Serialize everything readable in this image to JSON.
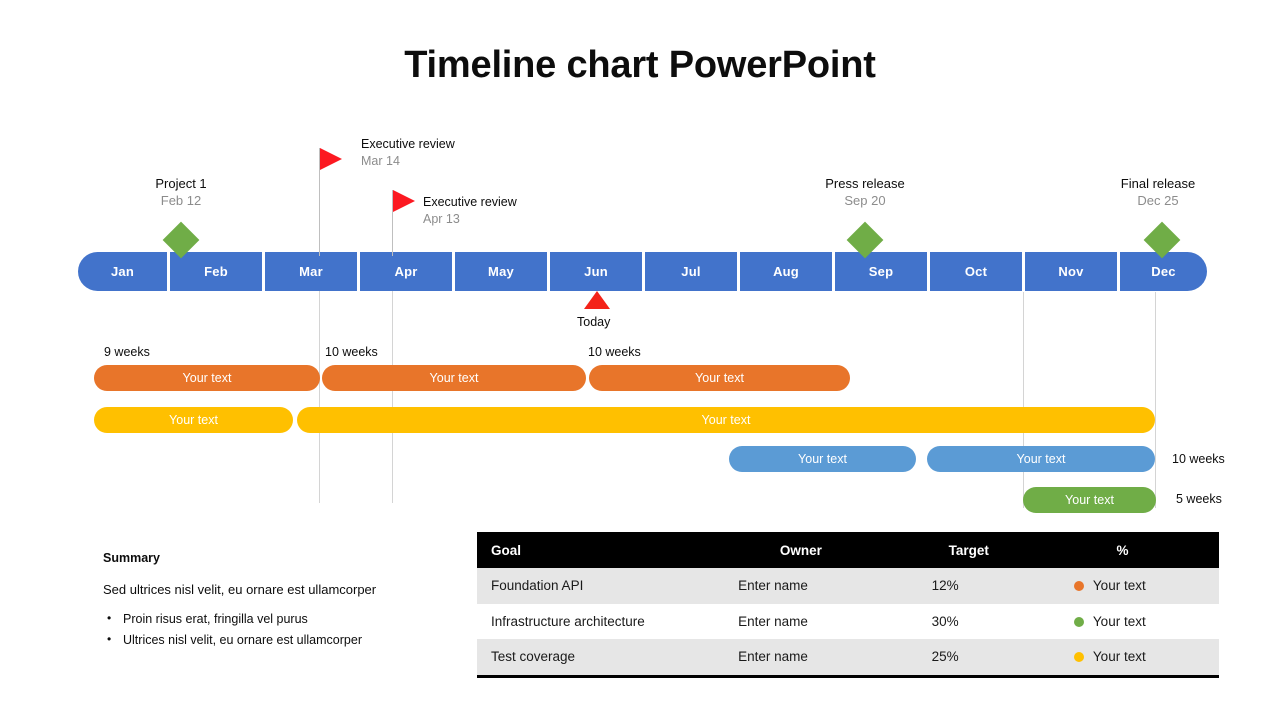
{
  "title": "Timeline chart PowerPoint",
  "colors": {
    "month_blue": "#4273cb",
    "milestone_green": "#70ad47",
    "flag_red": "#fc1921",
    "today_red": "#f42319",
    "bar_orange": "#e8752a",
    "bar_yellow": "#ffc000",
    "bar_blue": "#5b9bd5",
    "bar_green": "#70ad47",
    "table_header": "#000000",
    "table_alt_row": "#e6e6e6",
    "muted_text": "#8c8c8c"
  },
  "timeline": {
    "months": [
      "Jan",
      "Feb",
      "Mar",
      "Apr",
      "May",
      "Jun",
      "Jul",
      "Aug",
      "Sep",
      "Oct",
      "Nov",
      "Dec"
    ],
    "milestones": [
      {
        "name": "Project 1",
        "date": "Feb 12",
        "marker": "diamond"
      },
      {
        "name": "Press release",
        "date": "Sep 20",
        "marker": "diamond"
      },
      {
        "name": "Final release",
        "date": "Dec 25",
        "marker": "diamond"
      }
    ],
    "flags": [
      {
        "name": "Executive review",
        "date": "Mar 14",
        "marker": "flag"
      },
      {
        "name": "Executive review",
        "date": "Apr 13",
        "marker": "flag"
      }
    ],
    "today": {
      "label": "Today",
      "marker": "triangle"
    }
  },
  "tasks": {
    "row1": [
      {
        "label": "Your text",
        "duration": "9 weeks",
        "color": "orange"
      },
      {
        "label": "Your text",
        "duration": "10 weeks",
        "color": "orange"
      },
      {
        "label": "Your text",
        "duration": "10 weeks",
        "color": "orange"
      }
    ],
    "row2": [
      {
        "label": "Your text",
        "color": "yellow"
      },
      {
        "label": "Your text",
        "color": "yellow"
      }
    ],
    "row3": [
      {
        "label": "Your text",
        "color": "blue"
      },
      {
        "label": "Your text",
        "duration": "10 weeks",
        "color": "blue"
      }
    ],
    "row4": [
      {
        "label": "Your text",
        "duration": "5 weeks",
        "color": "green"
      }
    ]
  },
  "summary": {
    "heading": "Summary",
    "intro": "Sed ultrices nisl velit, eu ornare est ullamcorper",
    "bullets": [
      "Proin risus erat, fringilla vel purus",
      "Ultrices nisl velit, eu ornare est ullamcorper"
    ]
  },
  "table": {
    "columns": [
      "Goal",
      "Owner",
      "Target",
      "%"
    ],
    "rows": [
      {
        "goal": "Foundation API",
        "owner": "Enter name",
        "target": "12%",
        "pct_label": "Your text",
        "pct_color": "#e8752a"
      },
      {
        "goal": "Infrastructure architecture",
        "owner": "Enter name",
        "target": "30%",
        "pct_label": "Your text",
        "pct_color": "#70ad47"
      },
      {
        "goal": "Test coverage",
        "owner": "Enter name",
        "target": "25%",
        "pct_label": "Your text",
        "pct_color": "#ffc000"
      }
    ]
  }
}
